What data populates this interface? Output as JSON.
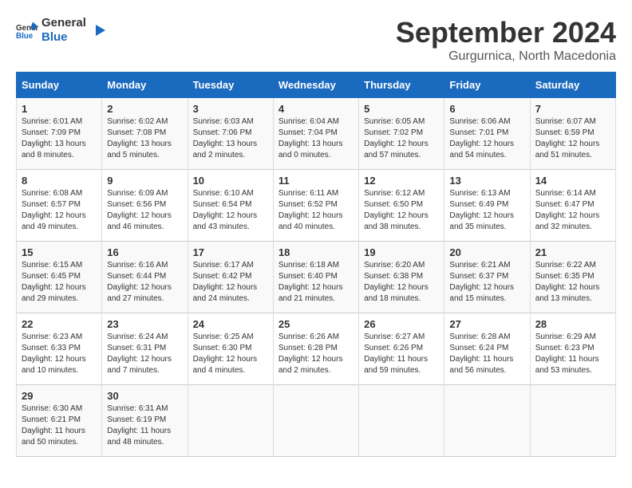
{
  "header": {
    "logo_line1": "General",
    "logo_line2": "Blue",
    "month_title": "September 2024",
    "subtitle": "Gurgurnica, North Macedonia"
  },
  "weekdays": [
    "Sunday",
    "Monday",
    "Tuesday",
    "Wednesday",
    "Thursday",
    "Friday",
    "Saturday"
  ],
  "weeks": [
    [
      {
        "day": "1",
        "info": "Sunrise: 6:01 AM\nSunset: 7:09 PM\nDaylight: 13 hours and 8 minutes."
      },
      {
        "day": "2",
        "info": "Sunrise: 6:02 AM\nSunset: 7:08 PM\nDaylight: 13 hours and 5 minutes."
      },
      {
        "day": "3",
        "info": "Sunrise: 6:03 AM\nSunset: 7:06 PM\nDaylight: 13 hours and 2 minutes."
      },
      {
        "day": "4",
        "info": "Sunrise: 6:04 AM\nSunset: 7:04 PM\nDaylight: 13 hours and 0 minutes."
      },
      {
        "day": "5",
        "info": "Sunrise: 6:05 AM\nSunset: 7:02 PM\nDaylight: 12 hours and 57 minutes."
      },
      {
        "day": "6",
        "info": "Sunrise: 6:06 AM\nSunset: 7:01 PM\nDaylight: 12 hours and 54 minutes."
      },
      {
        "day": "7",
        "info": "Sunrise: 6:07 AM\nSunset: 6:59 PM\nDaylight: 12 hours and 51 minutes."
      }
    ],
    [
      {
        "day": "8",
        "info": "Sunrise: 6:08 AM\nSunset: 6:57 PM\nDaylight: 12 hours and 49 minutes."
      },
      {
        "day": "9",
        "info": "Sunrise: 6:09 AM\nSunset: 6:56 PM\nDaylight: 12 hours and 46 minutes."
      },
      {
        "day": "10",
        "info": "Sunrise: 6:10 AM\nSunset: 6:54 PM\nDaylight: 12 hours and 43 minutes."
      },
      {
        "day": "11",
        "info": "Sunrise: 6:11 AM\nSunset: 6:52 PM\nDaylight: 12 hours and 40 minutes."
      },
      {
        "day": "12",
        "info": "Sunrise: 6:12 AM\nSunset: 6:50 PM\nDaylight: 12 hours and 38 minutes."
      },
      {
        "day": "13",
        "info": "Sunrise: 6:13 AM\nSunset: 6:49 PM\nDaylight: 12 hours and 35 minutes."
      },
      {
        "day": "14",
        "info": "Sunrise: 6:14 AM\nSunset: 6:47 PM\nDaylight: 12 hours and 32 minutes."
      }
    ],
    [
      {
        "day": "15",
        "info": "Sunrise: 6:15 AM\nSunset: 6:45 PM\nDaylight: 12 hours and 29 minutes."
      },
      {
        "day": "16",
        "info": "Sunrise: 6:16 AM\nSunset: 6:44 PM\nDaylight: 12 hours and 27 minutes."
      },
      {
        "day": "17",
        "info": "Sunrise: 6:17 AM\nSunset: 6:42 PM\nDaylight: 12 hours and 24 minutes."
      },
      {
        "day": "18",
        "info": "Sunrise: 6:18 AM\nSunset: 6:40 PM\nDaylight: 12 hours and 21 minutes."
      },
      {
        "day": "19",
        "info": "Sunrise: 6:20 AM\nSunset: 6:38 PM\nDaylight: 12 hours and 18 minutes."
      },
      {
        "day": "20",
        "info": "Sunrise: 6:21 AM\nSunset: 6:37 PM\nDaylight: 12 hours and 15 minutes."
      },
      {
        "day": "21",
        "info": "Sunrise: 6:22 AM\nSunset: 6:35 PM\nDaylight: 12 hours and 13 minutes."
      }
    ],
    [
      {
        "day": "22",
        "info": "Sunrise: 6:23 AM\nSunset: 6:33 PM\nDaylight: 12 hours and 10 minutes."
      },
      {
        "day": "23",
        "info": "Sunrise: 6:24 AM\nSunset: 6:31 PM\nDaylight: 12 hours and 7 minutes."
      },
      {
        "day": "24",
        "info": "Sunrise: 6:25 AM\nSunset: 6:30 PM\nDaylight: 12 hours and 4 minutes."
      },
      {
        "day": "25",
        "info": "Sunrise: 6:26 AM\nSunset: 6:28 PM\nDaylight: 12 hours and 2 minutes."
      },
      {
        "day": "26",
        "info": "Sunrise: 6:27 AM\nSunset: 6:26 PM\nDaylight: 11 hours and 59 minutes."
      },
      {
        "day": "27",
        "info": "Sunrise: 6:28 AM\nSunset: 6:24 PM\nDaylight: 11 hours and 56 minutes."
      },
      {
        "day": "28",
        "info": "Sunrise: 6:29 AM\nSunset: 6:23 PM\nDaylight: 11 hours and 53 minutes."
      }
    ],
    [
      {
        "day": "29",
        "info": "Sunrise: 6:30 AM\nSunset: 6:21 PM\nDaylight: 11 hours and 50 minutes."
      },
      {
        "day": "30",
        "info": "Sunrise: 6:31 AM\nSunset: 6:19 PM\nDaylight: 11 hours and 48 minutes."
      },
      {
        "day": "",
        "info": ""
      },
      {
        "day": "",
        "info": ""
      },
      {
        "day": "",
        "info": ""
      },
      {
        "day": "",
        "info": ""
      },
      {
        "day": "",
        "info": ""
      }
    ]
  ]
}
